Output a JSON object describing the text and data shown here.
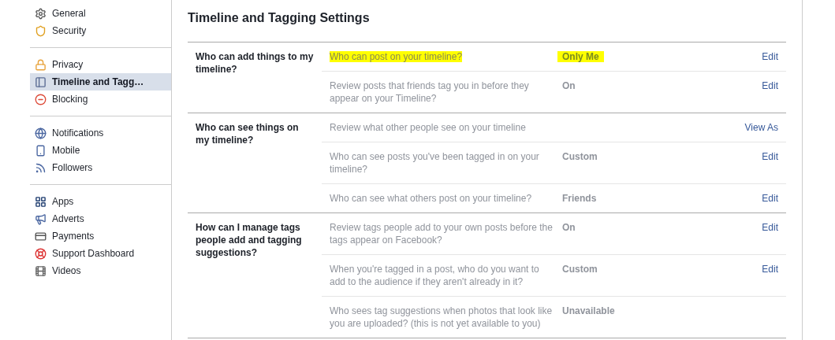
{
  "sidebar": {
    "groups": [
      {
        "items": [
          {
            "label": "General",
            "selected": false
          },
          {
            "label": "Security",
            "selected": false
          }
        ]
      },
      {
        "items": [
          {
            "label": "Privacy",
            "selected": false
          },
          {
            "label": "Timeline and Tagg…",
            "selected": true
          },
          {
            "label": "Blocking",
            "selected": false
          }
        ]
      },
      {
        "items": [
          {
            "label": "Notifications",
            "selected": false
          },
          {
            "label": "Mobile",
            "selected": false
          },
          {
            "label": "Followers",
            "selected": false
          }
        ]
      },
      {
        "items": [
          {
            "label": "Apps",
            "selected": false
          },
          {
            "label": "Adverts",
            "selected": false
          },
          {
            "label": "Payments",
            "selected": false
          },
          {
            "label": "Support Dashboard",
            "selected": false
          },
          {
            "label": "Videos",
            "selected": false
          }
        ]
      }
    ]
  },
  "page": {
    "title": "Timeline and Tagging Settings"
  },
  "sections": [
    {
      "label": "Who can add things to my timeline?",
      "rows": [
        {
          "question": "Who can post on your timeline?",
          "value": "Only Me",
          "action": "Edit",
          "highlighted": true
        },
        {
          "question": "Review posts that friends tag you in before they appear on your Timeline?",
          "value": "On",
          "action": "Edit",
          "highlighted": false
        }
      ]
    },
    {
      "label": "Who can see things on my timeline?",
      "rows": [
        {
          "question": "Review what other people see on your timeline",
          "action": "View As",
          "highlighted": false
        },
        {
          "question": "Who can see posts you've been tagged in on your timeline?",
          "value": "Custom",
          "action": "Edit",
          "highlighted": false
        },
        {
          "question": "Who can see what others post on your timeline?",
          "value": "Friends",
          "action": "Edit",
          "highlighted": false
        }
      ]
    },
    {
      "label": "How can I manage tags people add and tagging suggestions?",
      "rows": [
        {
          "question": "Review tags people add to your own posts before the tags appear on Facebook?",
          "value": "On",
          "action": "Edit",
          "highlighted": false
        },
        {
          "question": "When you're tagged in a post, who do you want to add to the audience if they aren't already in it?",
          "value": "Custom",
          "action": "Edit",
          "highlighted": false
        },
        {
          "question": "Who sees tag suggestions when photos that look like you are uploaded? (this is not yet available to you)",
          "value": "Unavailable",
          "highlighted": false
        }
      ]
    }
  ]
}
